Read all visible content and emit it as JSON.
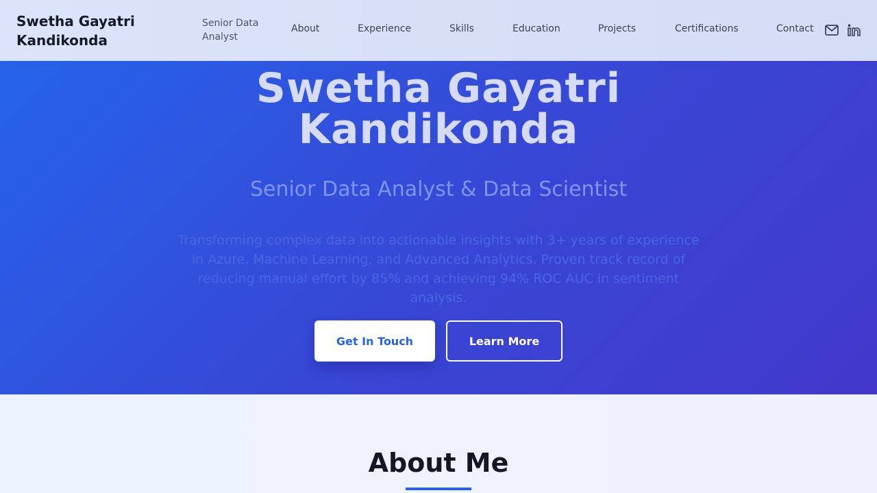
{
  "header": {
    "brand": "Swetha Gayatri Kandikonda",
    "tagline": "Senior Data Analyst",
    "nav": {
      "about": "About",
      "experience": "Experience",
      "skills": "Skills",
      "education": "Education",
      "projects": "Projects",
      "certifications": "Certifications",
      "contact": "Contact"
    },
    "icons": [
      "mail-icon",
      "linkedin-icon"
    ]
  },
  "hero": {
    "title_line1": "Swetha Gayatri",
    "title_line2": "Kandikonda",
    "subtitle": "Senior Data Analyst & Data Scientist",
    "description": "Transforming complex data into actionable insights with 3+ years of experience in Azure, Machine Learning, and Advanced Analytics. Proven track record of reducing manual effort by 85% and achieving 94% ROC AUC in sentiment analysis.",
    "primary_button": "Get In Touch",
    "secondary_button": "Learn More"
  },
  "about": {
    "title": "About Me"
  },
  "colors": {
    "accent": "#2563eb",
    "hero_start": "#2563eb",
    "hero_end": "#4338ca"
  }
}
